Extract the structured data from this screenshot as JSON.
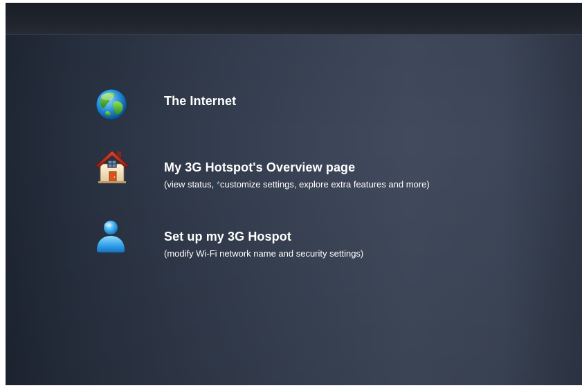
{
  "items": [
    {
      "icon": "globe-icon",
      "title": "The Internet",
      "subtitle": ""
    },
    {
      "icon": "house-icon",
      "title": "My 3G Hotspot's Overview page",
      "subtitle_pre": "(view status, ",
      "subtitle_mark": "*",
      "subtitle_post": "customize settings, explore extra features and more)"
    },
    {
      "icon": "user-icon",
      "title": "Set up my 3G Hospot",
      "subtitle": "(modify Wi-Fi network name and security settings)"
    }
  ],
  "colors": {
    "background": "#3a4456",
    "topbar": "#1f242d",
    "text": "#ffffff",
    "asterisk": "#5fc6f0"
  }
}
